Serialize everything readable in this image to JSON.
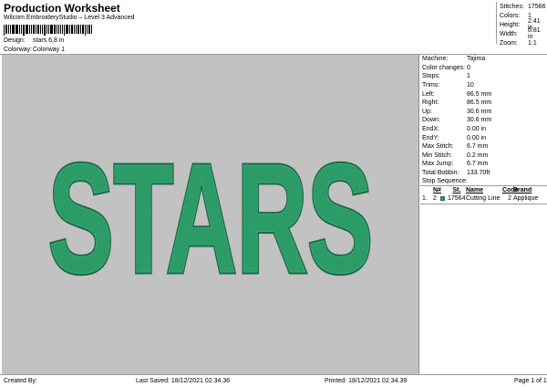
{
  "header": {
    "title": "Production Worksheet",
    "subtitle": "Wilcom EmbroideryStudio – Level 3 Advanced",
    "design_label": "Design:",
    "design_value": "stars 6,8 in",
    "colorway_label": "Colorway:",
    "colorway_value": "Colorway 1"
  },
  "stats": [
    {
      "label": "Stitches:",
      "value": "17566"
    },
    {
      "label": "Colors:",
      "value": "1"
    },
    {
      "label": "Height:",
      "value": "2.41 in"
    },
    {
      "label": "Width:",
      "value": "6.81 in"
    },
    {
      "label": "Zoom:",
      "value": "1:1"
    }
  ],
  "design": {
    "text": "STARS",
    "fill_color": "#2e9f6a",
    "outline_color": "#1f6a47",
    "background_color": "#c2c2c2"
  },
  "machine_info": [
    {
      "label": "Machine:",
      "value": "Tajima"
    },
    {
      "label": "Color changes:",
      "value": "0"
    },
    {
      "label": "Stops:",
      "value": "1"
    },
    {
      "label": "Trims:",
      "value": "10"
    },
    {
      "label": "Left:",
      "value": "86.5 mm"
    },
    {
      "label": "Right:",
      "value": "86.5 mm"
    },
    {
      "label": "Up:",
      "value": "30.6 mm"
    },
    {
      "label": "Down:",
      "value": "30.6 mm"
    },
    {
      "label": "EndX:",
      "value": "0.00 in"
    },
    {
      "label": "EndY:",
      "value": "0.00 in"
    },
    {
      "label": "Max Stitch:",
      "value": "6.7 mm"
    },
    {
      "label": "Min Stitch:",
      "value": "0.2 mm"
    },
    {
      "label": "Max Jump:",
      "value": "6.7 mm"
    },
    {
      "label": "Total Bobbin:",
      "value": "133.70ft"
    }
  ],
  "stop_sequence": {
    "title": "Stop Sequence:",
    "headers": {
      "n": "N#",
      "st": "St.",
      "name": "Name",
      "code": "Code",
      "brand": "Brand"
    },
    "rows": [
      {
        "idx": "1.",
        "n": "2",
        "color": "#2e9f6a",
        "st": "17564",
        "name": "Cutting Line",
        "code": "2",
        "brand": "Applique"
      }
    ]
  },
  "footer": {
    "created_by": "Created By:",
    "last_saved": "Last Saved: 18/12/2021 02.34.36",
    "printed": "Printed: 18/12/2021 02.34.39",
    "page": "Page 1 of 1"
  }
}
